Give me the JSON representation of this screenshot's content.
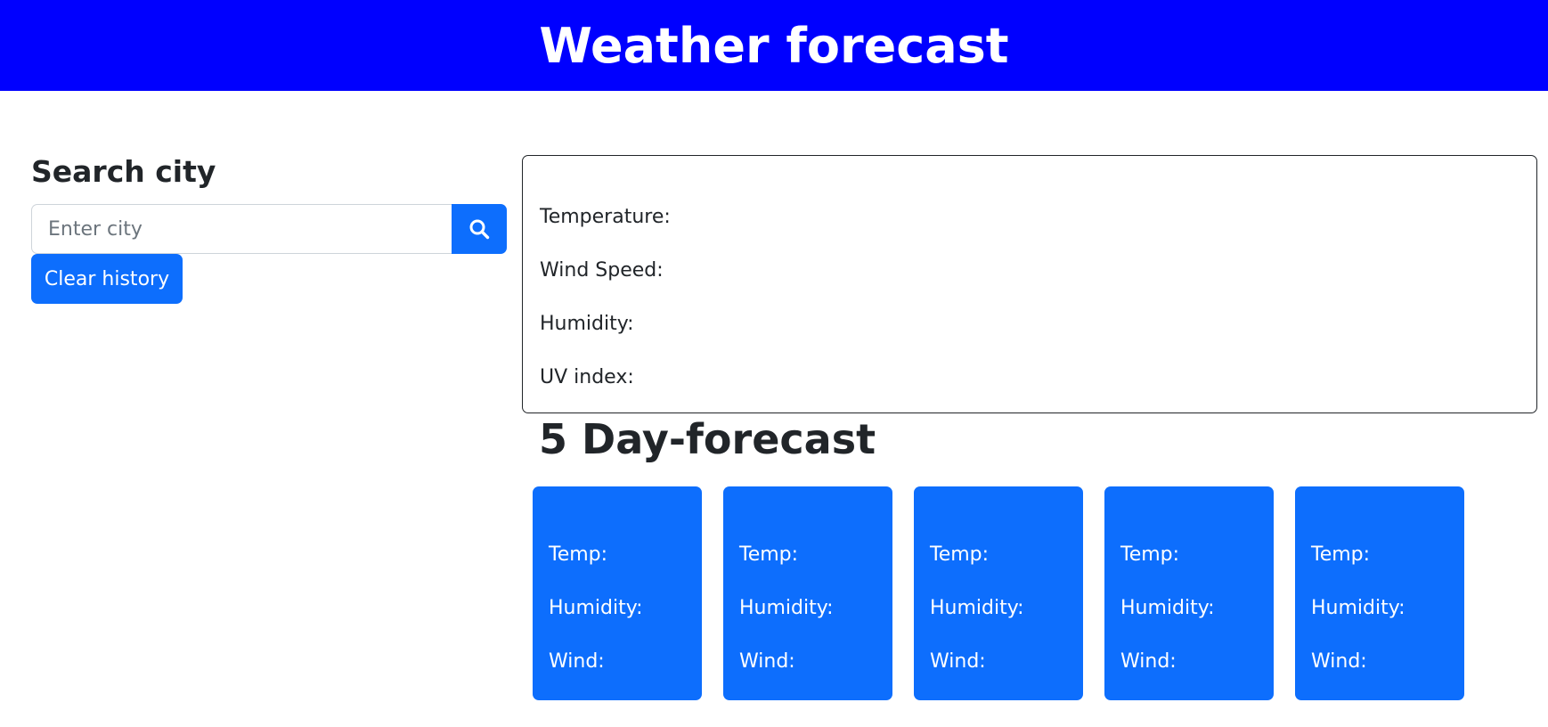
{
  "header": {
    "title": "Weather forecast",
    "background_color": "#0000ff"
  },
  "search": {
    "title": "Search city",
    "placeholder": "Enter city",
    "value": "",
    "button_icon": "search-icon",
    "clear_label": "Clear history",
    "accent_color": "#0d6efd"
  },
  "current": {
    "city": "",
    "temperature_label": "Temperature:",
    "wind_label": "Wind Speed:",
    "humidity_label": "Humidity:",
    "uv_label": "UV index:"
  },
  "forecast": {
    "title": "5 Day-forecast",
    "cards": [
      {
        "date": "",
        "temp_label": "Temp:",
        "humidity_label": "Humidity:",
        "wind_label": "Wind:"
      },
      {
        "date": "",
        "temp_label": "Temp:",
        "humidity_label": "Humidity:",
        "wind_label": "Wind:"
      },
      {
        "date": "",
        "temp_label": "Temp:",
        "humidity_label": "Humidity:",
        "wind_label": "Wind:"
      },
      {
        "date": "",
        "temp_label": "Temp:",
        "humidity_label": "Humidity:",
        "wind_label": "Wind:"
      },
      {
        "date": "",
        "temp_label": "Temp:",
        "humidity_label": "Humidity:",
        "wind_label": "Wind:"
      }
    ]
  }
}
